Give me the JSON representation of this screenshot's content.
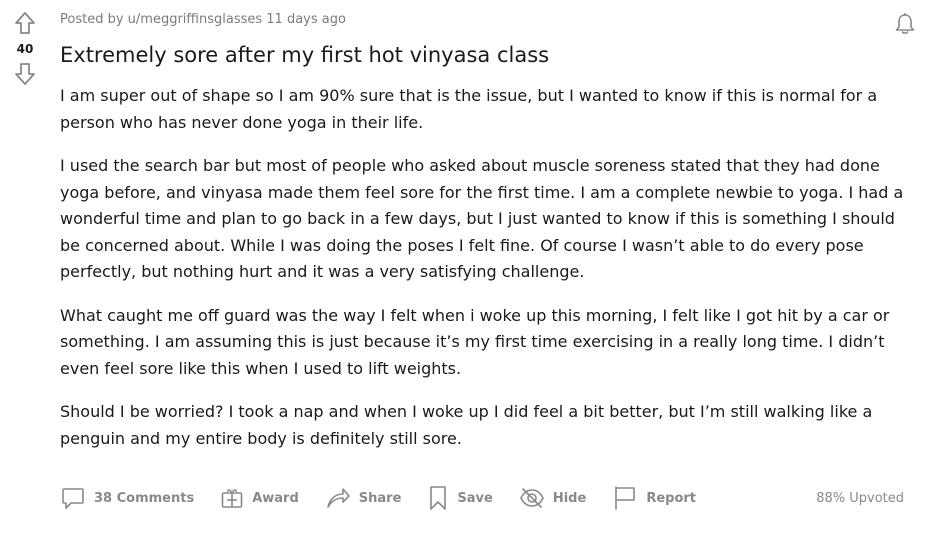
{
  "vote": {
    "count": "40"
  },
  "post": {
    "posted_by_prefix": "Posted by ",
    "author": "u/meggriffinsglasses",
    "time": " 11 days ago",
    "title": "Extremely sore after my first hot vinyasa class",
    "paragraphs": [
      "I am super out of shape so I am 90% sure that is the issue, but I wanted to know if this is normal for a person who has never done yoga in their life.",
      "I used the search bar but most of people who asked about muscle soreness stated that they had done yoga before, and vinyasa made them feel sore for the first time. I am a complete newbie to yoga. I had a wonderful time and plan to go back in a few days, but I just wanted to know if this is something I should be concerned about. While I was doing the poses I felt fine. Of course I wasn’t able to do every pose perfectly, but nothing hurt and it was a very satisfying challenge.",
      "What caught me off guard was the way I felt when i woke up this morning, I felt like I got hit by a car or something. I am assuming this is just because it’s my first time exercising in a really long time. I didn’t even feel sore like this when I used to lift weights.",
      "Should I be worried? I took a nap and when I woke up I did feel a bit better, but I’m still walking like a penguin and my entire body is definitely still sore."
    ]
  },
  "actions": {
    "comments": "38 Comments",
    "award": "Award",
    "share": "Share",
    "save": "Save",
    "hide": "Hide",
    "report": "Report",
    "upvoted": "88% Upvoted"
  },
  "icons": {
    "upvote": "upvote-arrow-icon",
    "downvote": "downvote-arrow-icon",
    "notify": "bell-icon",
    "comments": "comment-bubble-icon",
    "award": "gift-icon",
    "share": "share-arrow-icon",
    "save": "bookmark-icon",
    "hide": "eye-slash-icon",
    "report": "flag-icon"
  },
  "colors": {
    "text": "#1a1a1b",
    "muted": "#787c7e",
    "action": "#878a8c"
  }
}
